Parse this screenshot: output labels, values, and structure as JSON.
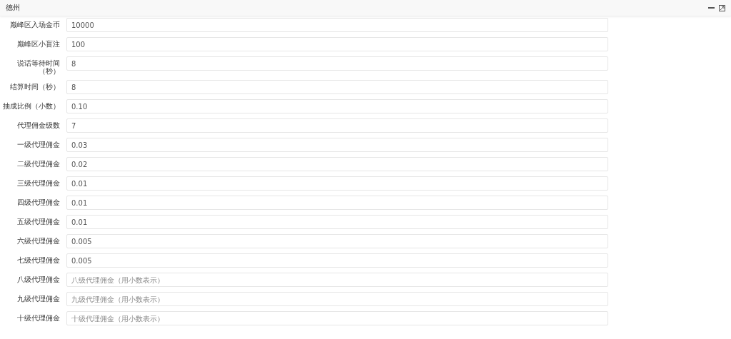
{
  "window": {
    "title": "德州"
  },
  "fields": [
    {
      "label": "巅峰区入场金币",
      "value": "10000"
    },
    {
      "label": "巅峰区小盲注",
      "value": "100"
    },
    {
      "label": "说话等待时间（秒）",
      "value": "8"
    },
    {
      "label": "结算时间（秒）",
      "value": "8"
    },
    {
      "label": "抽成比例（小数）",
      "value": "0.10"
    },
    {
      "label": "代理佣金级数",
      "value": "7"
    },
    {
      "label": "一级代理佣金",
      "value": "0.03"
    },
    {
      "label": "二级代理佣金",
      "value": "0.02"
    },
    {
      "label": "三级代理佣金",
      "value": "0.01"
    },
    {
      "label": "四级代理佣金",
      "value": "0.01"
    },
    {
      "label": "五级代理佣金",
      "value": "0.01"
    },
    {
      "label": "六级代理佣金",
      "value": "0.005"
    },
    {
      "label": "七级代理佣金",
      "value": "0.005"
    },
    {
      "label": "八级代理佣金",
      "placeholder": "八级代理佣金（用小数表示）"
    },
    {
      "label": "九级代理佣金",
      "placeholder": "九级代理佣金（用小数表示）"
    },
    {
      "label": "十级代理佣金",
      "placeholder": "十级代理佣金（用小数表示）"
    }
  ]
}
